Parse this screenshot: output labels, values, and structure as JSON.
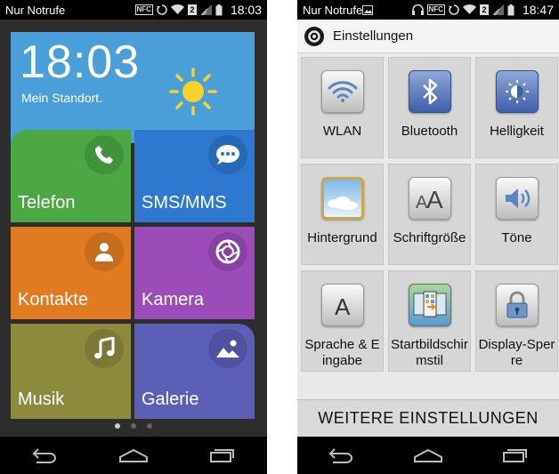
{
  "left": {
    "status": {
      "carrier": "Nur Notrufe",
      "time": "18:03",
      "nfc": "NFC",
      "sim": "2"
    },
    "clock": {
      "time": "18:03",
      "location": "Mein Standort."
    },
    "tiles": [
      {
        "label": "Telefon",
        "icon": "phone-icon"
      },
      {
        "label": "SMS/MMS",
        "icon": "chat-bubble-icon"
      },
      {
        "label": "Kontakte",
        "icon": "contact-person-icon"
      },
      {
        "label": "Kamera",
        "icon": "camera-shutter-icon"
      },
      {
        "label": "Musik",
        "icon": "music-note-icon"
      },
      {
        "label": "Galerie",
        "icon": "gallery-mountain-icon"
      }
    ],
    "pages": {
      "count": 3,
      "active": 1
    }
  },
  "right": {
    "status": {
      "carrier": "Nur Notrufe",
      "time": "18:47",
      "nfc": "NFC",
      "sim": "2"
    },
    "header": {
      "title": "Einstellungen"
    },
    "items": [
      {
        "label": "WLAN",
        "icon": "wifi-icon"
      },
      {
        "label": "Bluetooth",
        "icon": "bluetooth-icon"
      },
      {
        "label": "Helligkeit",
        "icon": "brightness-icon"
      },
      {
        "label": "Hintergrund",
        "icon": "wallpaper-icon"
      },
      {
        "label": "Schriftgröße",
        "icon": "font-size-icon"
      },
      {
        "label": "Töne",
        "icon": "speaker-icon"
      },
      {
        "label": "Sprache & Eingabe",
        "icon": "language-icon"
      },
      {
        "label": "Startbildschirmstil",
        "icon": "home-screen-style-icon"
      },
      {
        "label": "Display-Sperre",
        "icon": "lock-icon"
      }
    ],
    "more": "WEITERE EINSTELLUNGEN"
  },
  "colors": {
    "clock_tile": "#4a9fd8",
    "telefon": "#4ba844",
    "sms": "#2e78cf",
    "kontakte": "#e17b22",
    "kamera": "#9b4cb9",
    "musik": "#8c8a3d",
    "galerie": "#5b5fb6"
  }
}
